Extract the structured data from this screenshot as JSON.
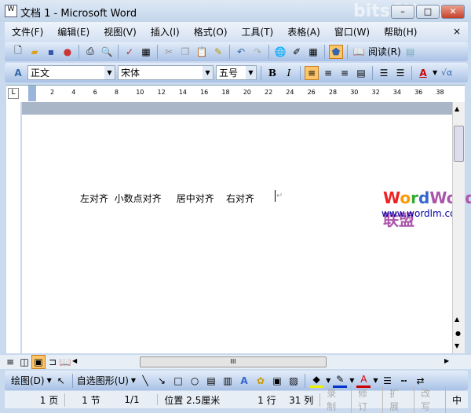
{
  "window": {
    "title": "文档 1 - Microsoft Word",
    "min": "–",
    "max": "□",
    "close": "✕"
  },
  "watermark_top": "bitsCN.com",
  "menu": [
    "文件(F)",
    "编辑(E)",
    "视图(V)",
    "插入(I)",
    "格式(O)",
    "工具(T)",
    "表格(A)",
    "窗口(W)",
    "帮助(H)"
  ],
  "menu_close": "×",
  "standard": {
    "read_label": "阅读(R)"
  },
  "format": {
    "style": "正文",
    "font": "宋体",
    "size": "五号",
    "bold": "B",
    "italic": "I",
    "font_color": "A",
    "symbol": "√α"
  },
  "ruler": [
    "2",
    "4",
    "6",
    "8",
    "10",
    "12",
    "14",
    "16",
    "18",
    "20",
    "22",
    "24",
    "26",
    "28",
    "30",
    "32",
    "34",
    "36",
    "38"
  ],
  "document": {
    "text": "左对齐  小数点对齐     居中对齐    右对齐",
    "para_mark": "↵"
  },
  "logo": {
    "name": "Word联盟",
    "url": "www.wordlm.com"
  },
  "hscroll_grip": "III",
  "drawing": {
    "draw_label": "绘图(D)",
    "autoshapes_label": "自选图形(U)"
  },
  "status": {
    "page": "1 页",
    "section": "1 节",
    "pages": "1/1",
    "position": "位置 2.5厘米",
    "line": "1 行",
    "col": "31 列",
    "rec": "录制",
    "trk": "修订",
    "ext": "扩展",
    "ovr": "改写",
    "lang": "中"
  }
}
